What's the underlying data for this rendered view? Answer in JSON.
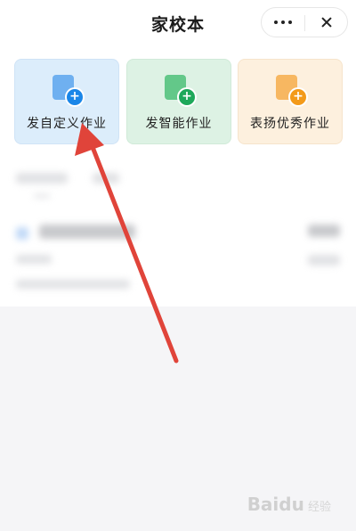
{
  "header": {
    "title": "家校本"
  },
  "actions": [
    {
      "label": "发自定义作业",
      "icon": "custom-homework-icon",
      "color": "#1a86e8"
    },
    {
      "label": "发智能作业",
      "icon": "smart-homework-icon",
      "color": "#1ea85a"
    },
    {
      "label": "表扬优秀作业",
      "icon": "praise-homework-icon",
      "color": "#f39a1a"
    }
  ],
  "annotation": {
    "arrow_color": "#e0443a"
  },
  "watermark": {
    "brand": "Baidu",
    "sub": "经验"
  }
}
